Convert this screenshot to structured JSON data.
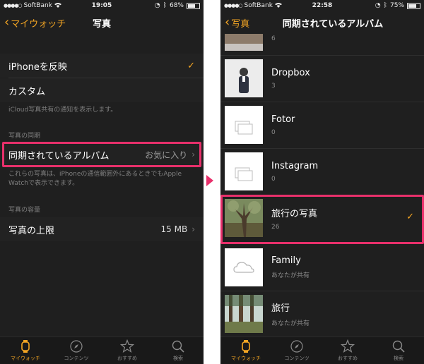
{
  "left": {
    "status": {
      "carrier": "SoftBank",
      "time": "19:05",
      "battery": "68%",
      "battery_level": 0.68
    },
    "nav": {
      "back_label": "マイウォッチ",
      "title": "写真"
    },
    "mirror_options": [
      {
        "label": "iPhoneを反映",
        "checked": true
      },
      {
        "label": "カスタム",
        "checked": false
      }
    ],
    "mirror_footnote": "iCloud写真共有の通知を表示します。",
    "sync_header": "写真の同期",
    "sync_cell": {
      "label": "同期されているアルバム",
      "value": "お気に入り"
    },
    "sync_footnote": "これらの写真は、iPhoneの通信範囲外にあるときでもApple Watchで表示できます。",
    "capacity_header": "写真の容量",
    "capacity_cell": {
      "label": "写真の上限",
      "value": "15 MB"
    }
  },
  "right": {
    "status": {
      "carrier": "SoftBank",
      "time": "22:58",
      "battery": "75%",
      "battery_level": 0.75
    },
    "nav": {
      "back_label": "写真",
      "title": "同期されているアルバム"
    },
    "top_partial_count": "6",
    "albums": [
      {
        "name": "Dropbox",
        "count": "3",
        "thumb": "person-photo",
        "checked": false
      },
      {
        "name": "Fotor",
        "count": "0",
        "thumb": "folder-icon",
        "checked": false
      },
      {
        "name": "Instagram",
        "count": "0",
        "thumb": "folder-icon",
        "checked": false
      },
      {
        "name": "旅行の写真",
        "count": "26",
        "thumb": "tree-photo",
        "checked": true
      },
      {
        "name": "Family",
        "count": "あなたが共有",
        "thumb": "cloud-icon",
        "checked": false
      },
      {
        "name": "旅行",
        "count": "あなたが共有",
        "thumb": "forest-photo",
        "checked": false
      }
    ]
  },
  "tabs": [
    {
      "label": "マイウォッチ",
      "icon": "watch-icon",
      "active": true
    },
    {
      "label": "コンテンツ",
      "icon": "compass-icon",
      "active": false
    },
    {
      "label": "おすすめ",
      "icon": "star-icon",
      "active": false
    },
    {
      "label": "検索",
      "icon": "search-icon",
      "active": false
    }
  ],
  "colors": {
    "accent": "#f5a623",
    "highlight": "#e8306b",
    "background": "#1f1f1f"
  }
}
